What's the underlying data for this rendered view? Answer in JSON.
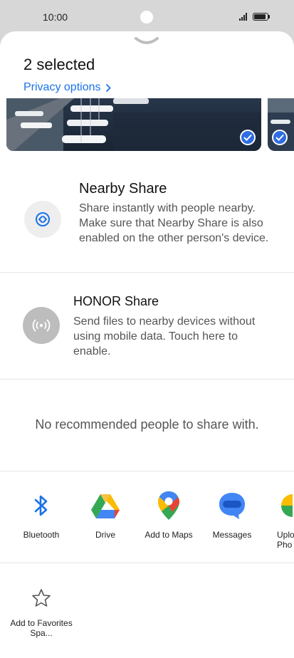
{
  "status_bar": {
    "time": "10:00"
  },
  "sheet": {
    "title": "2 selected",
    "privacy_link": "Privacy options"
  },
  "share_options": [
    {
      "title": "Nearby Share",
      "description": "Share instantly with people nearby. Make sure that Nearby Share is also enabled on the other person's device.",
      "icon": "nearby-share-icon"
    },
    {
      "title": "HONOR Share",
      "description": "Send files to nearby devices without using mobile data. Touch here to enable.",
      "icon": "honor-share-icon"
    }
  ],
  "recommendations": {
    "empty_message": "No recommended people to share with."
  },
  "apps": [
    {
      "label": "Bluetooth",
      "icon": "bluetooth-icon"
    },
    {
      "label": "Drive",
      "icon": "drive-icon"
    },
    {
      "label": "Add to Maps",
      "icon": "maps-icon"
    },
    {
      "label": "Messages",
      "icon": "messages-icon"
    },
    {
      "label": "Uplo Pho",
      "icon": "photos-icon"
    }
  ],
  "favorites": {
    "label": "Add to Favorites Spa...",
    "icon": "star-icon"
  },
  "colors": {
    "accent": "#1a73e8",
    "check": "#2f6de1"
  }
}
